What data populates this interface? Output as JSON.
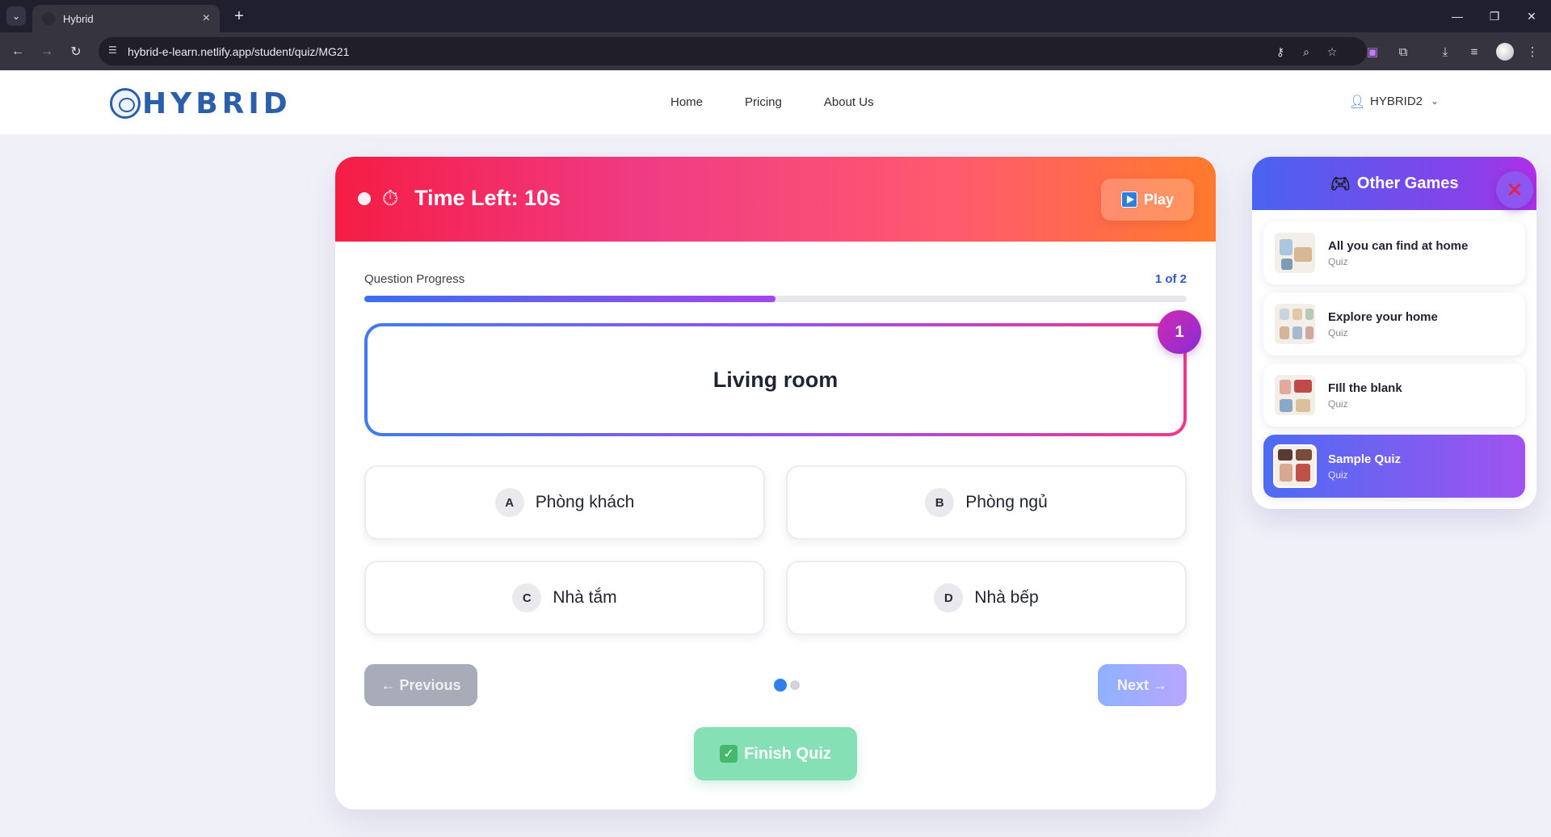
{
  "browser": {
    "tab_title": "Hybrid",
    "url": "hybrid-e-learn.netlify.app/student/quiz/MG21"
  },
  "header": {
    "logo_text": "HYBRID",
    "nav": [
      "Home",
      "Pricing",
      "About Us"
    ],
    "username": "HYBRID2"
  },
  "quiz": {
    "timer_text": "Time Left: 10s",
    "play_label": "Play",
    "progress_label": "Question Progress",
    "progress_count": "1 of 2",
    "progress_fraction": 0.5,
    "question_number": "1",
    "question": "Living room",
    "options": [
      {
        "letter": "A",
        "text": "Phòng khách"
      },
      {
        "letter": "B",
        "text": "Phòng ngủ"
      },
      {
        "letter": "C",
        "text": "Nhà tắm"
      },
      {
        "letter": "D",
        "text": "Nhà bếp"
      }
    ],
    "prev_label": "← Previous",
    "next_label": "Next →",
    "finish_label": "Finish Quiz",
    "current_page": 1,
    "total_pages": 2
  },
  "other_games": {
    "title": "Other Games",
    "items": [
      {
        "title": "All you can find at home",
        "type": "Quiz",
        "active": false
      },
      {
        "title": "Explore your home",
        "type": "Quiz",
        "active": false
      },
      {
        "title": "FIll the blank",
        "type": "Quiz",
        "active": false
      },
      {
        "title": "Sample Quiz",
        "type": "Quiz",
        "active": true
      }
    ]
  },
  "icons": {
    "timer": "stopwatch-icon",
    "play": "play-icon",
    "gamepad": "gamepad-icon",
    "close": "close-icon",
    "user": "user-icon",
    "check": "check-icon"
  },
  "colors": {
    "accent_blue": "#2f80ed",
    "header_gradient_start": "#f51d45",
    "header_gradient_end": "#ff7a2c",
    "panel_gradient_start": "#4a63f2",
    "panel_gradient_end": "#b02fe8",
    "finish_green": "#86e0b6"
  }
}
